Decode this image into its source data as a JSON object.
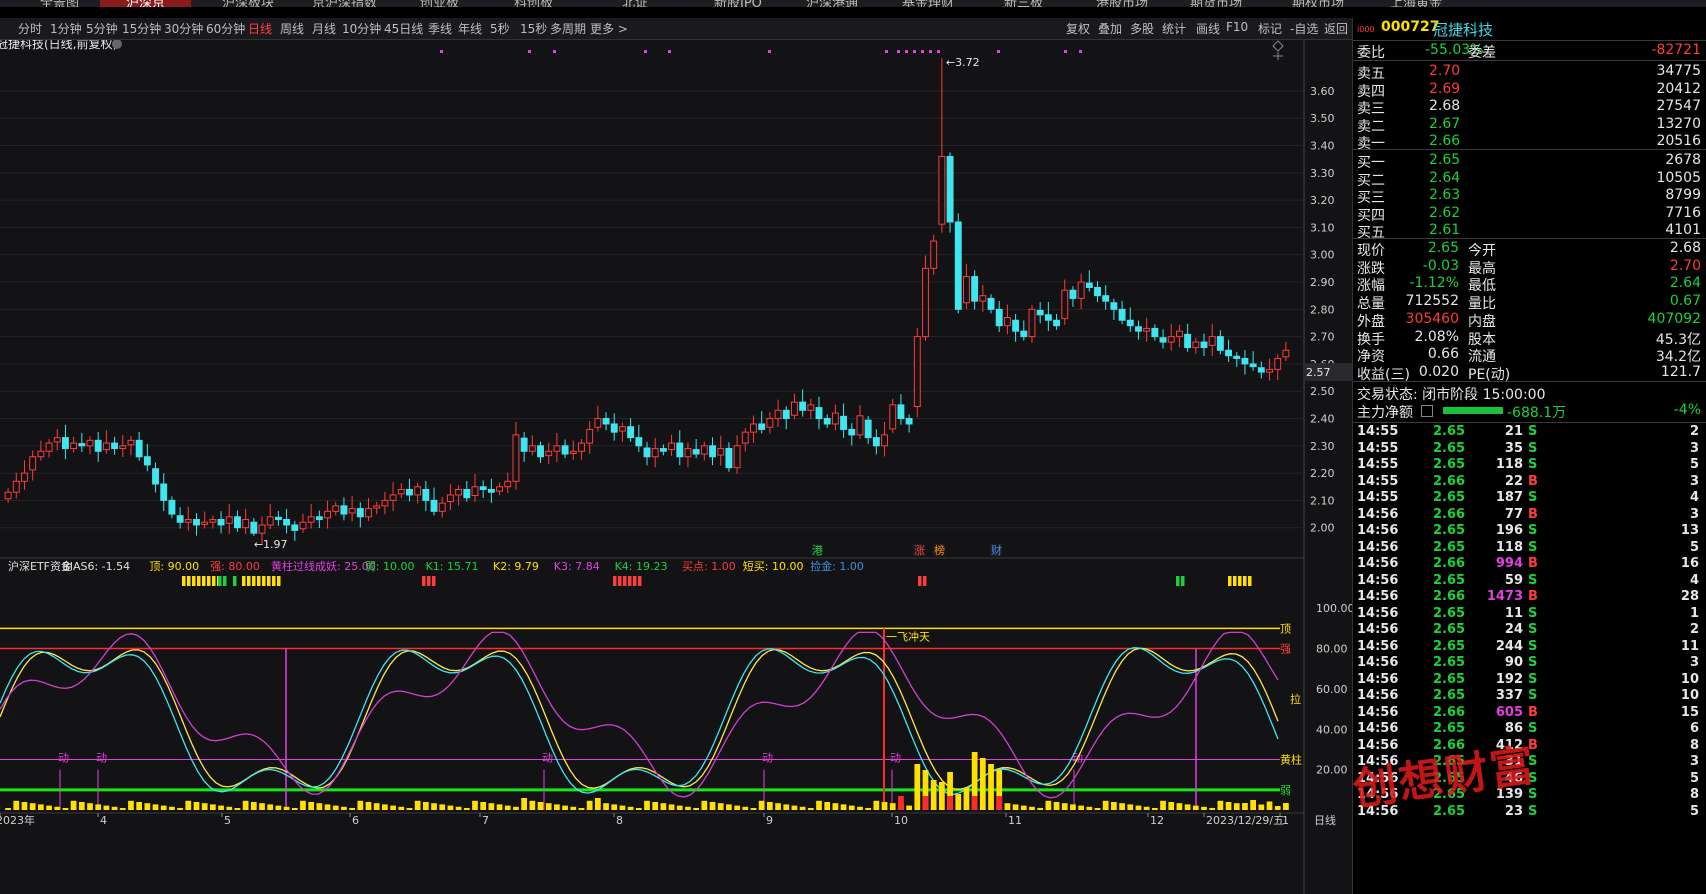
{
  "nav": [
    "全景图",
    "沪深京",
    "沪深板块",
    "京沪深指数",
    "创业板",
    "科创板",
    "北证",
    "新股IPO",
    "沪深港通",
    "基金理财",
    "新三板",
    "港股市场",
    "期货市场",
    "期权市场",
    "上海黄金"
  ],
  "nav_active": 1,
  "toolbar_left": [
    "分时",
    "1分钟",
    "5分钟",
    "15分钟",
    "30分钟",
    "60分钟",
    "日线",
    "周线",
    "月线",
    "10分钟",
    "45日线",
    "季线",
    "年线",
    "5秒",
    "15秒",
    "多周期",
    "更多 >"
  ],
  "toolbar_active": 6,
  "toolbar_right": [
    "复权",
    "叠加",
    "多股",
    "统计",
    "画线",
    "F10",
    "标记",
    "-自选",
    "返回"
  ],
  "chart_title": "冠捷科技(日线,前复权)",
  "price_max_label": "3.72",
  "price_min_label": "1.97",
  "current_price_tag": "2.57",
  "indicator_line": [
    {
      "t": "沪深ETF资金",
      "c": "#e0e0e0"
    },
    {
      "t": "BIAS6: -1.54",
      "c": "#e0e0e0"
    },
    {
      "t": "顶: 90.00",
      "c": "#ffe000"
    },
    {
      "t": "强: 80.00",
      "c": "#ff3b3b"
    },
    {
      "t": "黄柱过线成妖: 25.00",
      "c": "#e040e0"
    },
    {
      "t": "弱: 10.00",
      "c": "#19d23a"
    },
    {
      "t": "K1: 15.71",
      "c": "#19d23a"
    },
    {
      "t": "K2: 9.79",
      "c": "#ffe000"
    },
    {
      "t": "K3: 7.84",
      "c": "#e040e0"
    },
    {
      "t": "K4: 19.23",
      "c": "#19d23a"
    },
    {
      "t": "买点: 1.00",
      "c": "#ff3b3b"
    },
    {
      "t": "短买: 10.00",
      "c": "#ffe000"
    },
    {
      "t": "捡金: 1.00",
      "c": "#3f8fe6"
    }
  ],
  "event_labels": [
    {
      "t": "港",
      "c": "#19d23a"
    },
    {
      "t": "涨",
      "c": "#ff3b3b"
    },
    {
      "t": "榜",
      "c": "#ff8c00"
    },
    {
      "t": "财",
      "c": "#3f8fe6"
    }
  ],
  "osc_labels": {
    "top": "顶",
    "strong": "强",
    "yellow_col": "黄柱",
    "weak": "弱",
    "pull": "拉",
    "dong": "动",
    "yfct": "一飞冲天"
  },
  "x_axis": [
    "2023年",
    "4",
    "5",
    "6",
    "7",
    "8",
    "9",
    "10",
    "11",
    "12",
    "2023/12/29/五",
    "1"
  ],
  "x_axis_right": "日线",
  "chart_data": {
    "type": "candlestick",
    "title": "冠捷科技(日线,前复权)",
    "y_ticks": [
      3.6,
      3.5,
      3.4,
      3.3,
      3.2,
      3.1,
      3.0,
      2.9,
      2.8,
      2.7,
      2.6,
      2.5,
      2.4,
      2.3,
      2.2,
      2.1,
      2.0
    ],
    "ylim": [
      1.9,
      3.75
    ],
    "closes": [
      2.13,
      2.17,
      2.2,
      2.26,
      2.28,
      2.31,
      2.33,
      2.29,
      2.31,
      2.3,
      2.32,
      2.28,
      2.31,
      2.29,
      2.3,
      2.32,
      2.26,
      2.23,
      2.16,
      2.1,
      2.05,
      2.02,
      2.03,
      2.01,
      2.02,
      2.03,
      2.01,
      2.04,
      2.0,
      2.03,
      1.98,
      2.01,
      2.04,
      2.03,
      2.01,
      1.99,
      2.02,
      2.04,
      2.03,
      2.06,
      2.08,
      2.05,
      2.07,
      2.04,
      2.07,
      2.08,
      2.1,
      2.12,
      2.14,
      2.12,
      2.15,
      2.1,
      2.06,
      2.09,
      2.12,
      2.14,
      2.11,
      2.15,
      2.14,
      2.13,
      2.15,
      2.17,
      2.34,
      2.28,
      2.3,
      2.26,
      2.28,
      2.3,
      2.27,
      2.28,
      2.31,
      2.36,
      2.4,
      2.38,
      2.35,
      2.37,
      2.33,
      2.3,
      2.26,
      2.29,
      2.28,
      2.31,
      2.26,
      2.29,
      2.27,
      2.3,
      2.26,
      2.29,
      2.22,
      2.3,
      2.35,
      2.38,
      2.36,
      2.4,
      2.43,
      2.4,
      2.46,
      2.43,
      2.45,
      2.4,
      2.38,
      2.42,
      2.36,
      2.34,
      2.41,
      2.33,
      2.3,
      2.34,
      2.45,
      2.4,
      2.38,
      2.7,
      2.95,
      3.05,
      3.36,
      3.12,
      2.8,
      2.92,
      2.83,
      2.85,
      2.8,
      2.74,
      2.77,
      2.72,
      2.7,
      2.8,
      2.78,
      2.76,
      2.74,
      2.87,
      2.84,
      2.9,
      2.88,
      2.85,
      2.83,
      2.8,
      2.76,
      2.74,
      2.72,
      2.73,
      2.7,
      2.68,
      2.7,
      2.72,
      2.66,
      2.68,
      2.66,
      2.7,
      2.65,
      2.63,
      2.62,
      2.6,
      2.59,
      2.57,
      2.58,
      2.62,
      2.65
    ],
    "price_high": 3.72,
    "price_low": 1.97
  },
  "osc": {
    "ylim": [
      0,
      110
    ],
    "y_ticks": [
      100.0,
      80.0,
      60.0,
      40.0,
      20.0
    ],
    "levels": {
      "top": 90,
      "strong": 80,
      "yellow": 25,
      "weak": 10
    }
  },
  "rp": {
    "code": "000727",
    "name": "冠捷科技",
    "webi": {
      "l1": "委比",
      "v1": "-55.03%",
      "l2": "委差",
      "v2": "-82721"
    },
    "asks": [
      {
        "l": "卖五",
        "p": "2.70",
        "v": "34775",
        "pc": "red"
      },
      {
        "l": "卖四",
        "p": "2.69",
        "v": "20412",
        "pc": "red"
      },
      {
        "l": "卖三",
        "p": "2.68",
        "v": "27547",
        "pc": "white"
      },
      {
        "l": "卖二",
        "p": "2.67",
        "v": "13270",
        "pc": "green"
      },
      {
        "l": "卖一",
        "p": "2.66",
        "v": "20516",
        "pc": "green"
      }
    ],
    "bids": [
      {
        "l": "买一",
        "p": "2.65",
        "v": "2678",
        "pc": "green"
      },
      {
        "l": "买二",
        "p": "2.64",
        "v": "10505",
        "pc": "green"
      },
      {
        "l": "买三",
        "p": "2.63",
        "v": "8799",
        "pc": "green"
      },
      {
        "l": "买四",
        "p": "2.62",
        "v": "7716",
        "pc": "green"
      },
      {
        "l": "买五",
        "p": "2.61",
        "v": "4101",
        "pc": "green"
      }
    ],
    "stats": [
      {
        "l1": "现价",
        "v1": "2.65",
        "c1": "green",
        "l2": "今开",
        "v2": "2.68",
        "c2": "white"
      },
      {
        "l1": "涨跌",
        "v1": "-0.03",
        "c1": "green",
        "l2": "最高",
        "v2": "2.70",
        "c2": "red"
      },
      {
        "l1": "涨幅",
        "v1": "-1.12%",
        "c1": "green",
        "l2": "最低",
        "v2": "2.64",
        "c2": "green"
      },
      {
        "l1": "总量",
        "v1": "712552",
        "c1": "white",
        "l2": "量比",
        "v2": "0.67",
        "c2": "green"
      },
      {
        "l1": "外盘",
        "v1": "305460",
        "c1": "red",
        "l2": "内盘",
        "v2": "407092",
        "c2": "green"
      },
      {
        "l1": "换手",
        "v1": "2.08%",
        "c1": "white",
        "l2": "股本",
        "v2": "45.3亿",
        "c2": "white"
      },
      {
        "l1": "净资",
        "v1": "0.66",
        "c1": "white",
        "l2": "流通",
        "v2": "34.2亿",
        "c2": "white"
      },
      {
        "l1": "收益(三)",
        "v1": "0.020",
        "c1": "white",
        "l2": "PE(动)",
        "v2": "121.7",
        "c2": "white"
      }
    ],
    "trade_status": "交易状态: 闭市阶段 15:00:00",
    "main_flow_label": "主力净额",
    "main_flow_val": "-688.1万",
    "main_flow_pct": "-4%",
    "ticks": [
      {
        "t": "14:55",
        "p": "2.65",
        "pc": "green",
        "v": "21",
        "vc": "white",
        "s": "S",
        "n": "2"
      },
      {
        "t": "14:55",
        "p": "2.65",
        "pc": "green",
        "v": "35",
        "vc": "white",
        "s": "S",
        "n": "3"
      },
      {
        "t": "14:55",
        "p": "2.65",
        "pc": "green",
        "v": "118",
        "vc": "white",
        "s": "S",
        "n": "5"
      },
      {
        "t": "14:55",
        "p": "2.66",
        "pc": "green",
        "v": "22",
        "vc": "white",
        "s": "B",
        "n": "3"
      },
      {
        "t": "14:55",
        "p": "2.65",
        "pc": "green",
        "v": "187",
        "vc": "white",
        "s": "S",
        "n": "4"
      },
      {
        "t": "14:56",
        "p": "2.66",
        "pc": "green",
        "v": "77",
        "vc": "white",
        "s": "B",
        "n": "3"
      },
      {
        "t": "14:56",
        "p": "2.65",
        "pc": "green",
        "v": "196",
        "vc": "white",
        "s": "S",
        "n": "13"
      },
      {
        "t": "14:56",
        "p": "2.65",
        "pc": "green",
        "v": "118",
        "vc": "white",
        "s": "S",
        "n": "5"
      },
      {
        "t": "14:56",
        "p": "2.66",
        "pc": "green",
        "v": "994",
        "vc": "magenta",
        "s": "B",
        "n": "16"
      },
      {
        "t": "14:56",
        "p": "2.65",
        "pc": "green",
        "v": "59",
        "vc": "white",
        "s": "S",
        "n": "4"
      },
      {
        "t": "14:56",
        "p": "2.66",
        "pc": "green",
        "v": "1473",
        "vc": "magenta",
        "s": "B",
        "n": "28"
      },
      {
        "t": "14:56",
        "p": "2.65",
        "pc": "green",
        "v": "11",
        "vc": "white",
        "s": "S",
        "n": "1"
      },
      {
        "t": "14:56",
        "p": "2.65",
        "pc": "green",
        "v": "24",
        "vc": "white",
        "s": "S",
        "n": "2"
      },
      {
        "t": "14:56",
        "p": "2.65",
        "pc": "green",
        "v": "244",
        "vc": "white",
        "s": "S",
        "n": "11"
      },
      {
        "t": "14:56",
        "p": "2.65",
        "pc": "green",
        "v": "90",
        "vc": "white",
        "s": "S",
        "n": "3"
      },
      {
        "t": "14:56",
        "p": "2.65",
        "pc": "green",
        "v": "192",
        "vc": "white",
        "s": "S",
        "n": "10"
      },
      {
        "t": "14:56",
        "p": "2.65",
        "pc": "green",
        "v": "337",
        "vc": "white",
        "s": "S",
        "n": "10"
      },
      {
        "t": "14:56",
        "p": "2.66",
        "pc": "green",
        "v": "605",
        "vc": "magenta",
        "s": "B",
        "n": "15"
      },
      {
        "t": "14:56",
        "p": "2.65",
        "pc": "green",
        "v": "86",
        "vc": "white",
        "s": "S",
        "n": "6"
      },
      {
        "t": "14:56",
        "p": "2.66",
        "pc": "green",
        "v": "412",
        "vc": "white",
        "s": "B",
        "n": "8"
      },
      {
        "t": "14:56",
        "p": "2.65",
        "pc": "green",
        "v": "31",
        "vc": "white",
        "s": "S",
        "n": "3"
      },
      {
        "t": "14:56",
        "p": "2.65",
        "pc": "green",
        "v": "46",
        "vc": "white",
        "s": "S",
        "n": "5"
      },
      {
        "t": "14:56",
        "p": "2.65",
        "pc": "green",
        "v": "139",
        "vc": "white",
        "s": "S",
        "n": "8"
      },
      {
        "t": "14:56",
        "p": "2.65",
        "pc": "green",
        "v": "23",
        "vc": "white",
        "s": "S",
        "n": "5"
      }
    ],
    "watermark": "创想财富"
  }
}
